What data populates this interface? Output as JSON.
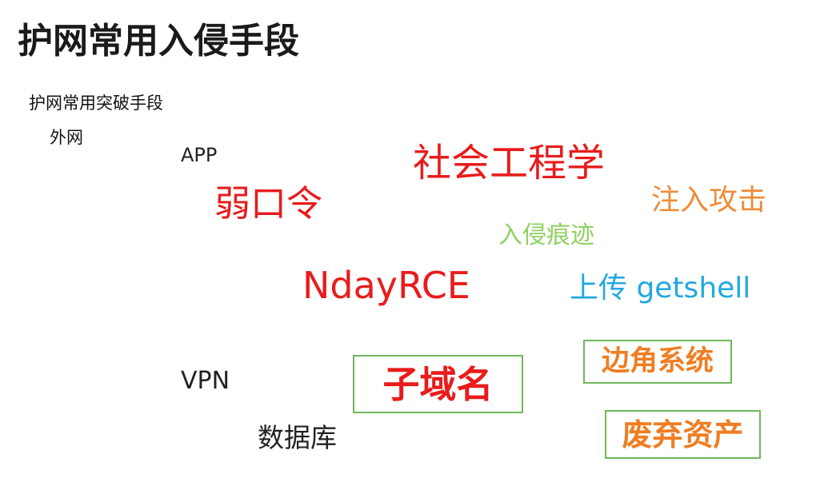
{
  "slide": {
    "title": "护网常用入侵手段",
    "subtitle": "护网常用突破手段",
    "outer_network": "外网"
  },
  "words": {
    "app": "APP",
    "social_engineering": "社会工程学",
    "weak_password": "弱口令",
    "injection_attack": "注入攻击",
    "intrusion_traces": "入侵痕迹",
    "nday_rce": "NdayRCE",
    "upload_getshell": "上传 getshell",
    "vpn": "VPN",
    "database": "数据库"
  },
  "boxed": {
    "subdomain": "子域名",
    "edge_systems": "边角系统",
    "abandoned_assets": "废弃资产"
  },
  "colors": {
    "red": "#e81c1c",
    "orange": "#ef7d22",
    "light_orange": "#ef8c3a",
    "light_green": "#8fd160",
    "blue": "#23a8e0",
    "box_border": "#70b85a"
  }
}
